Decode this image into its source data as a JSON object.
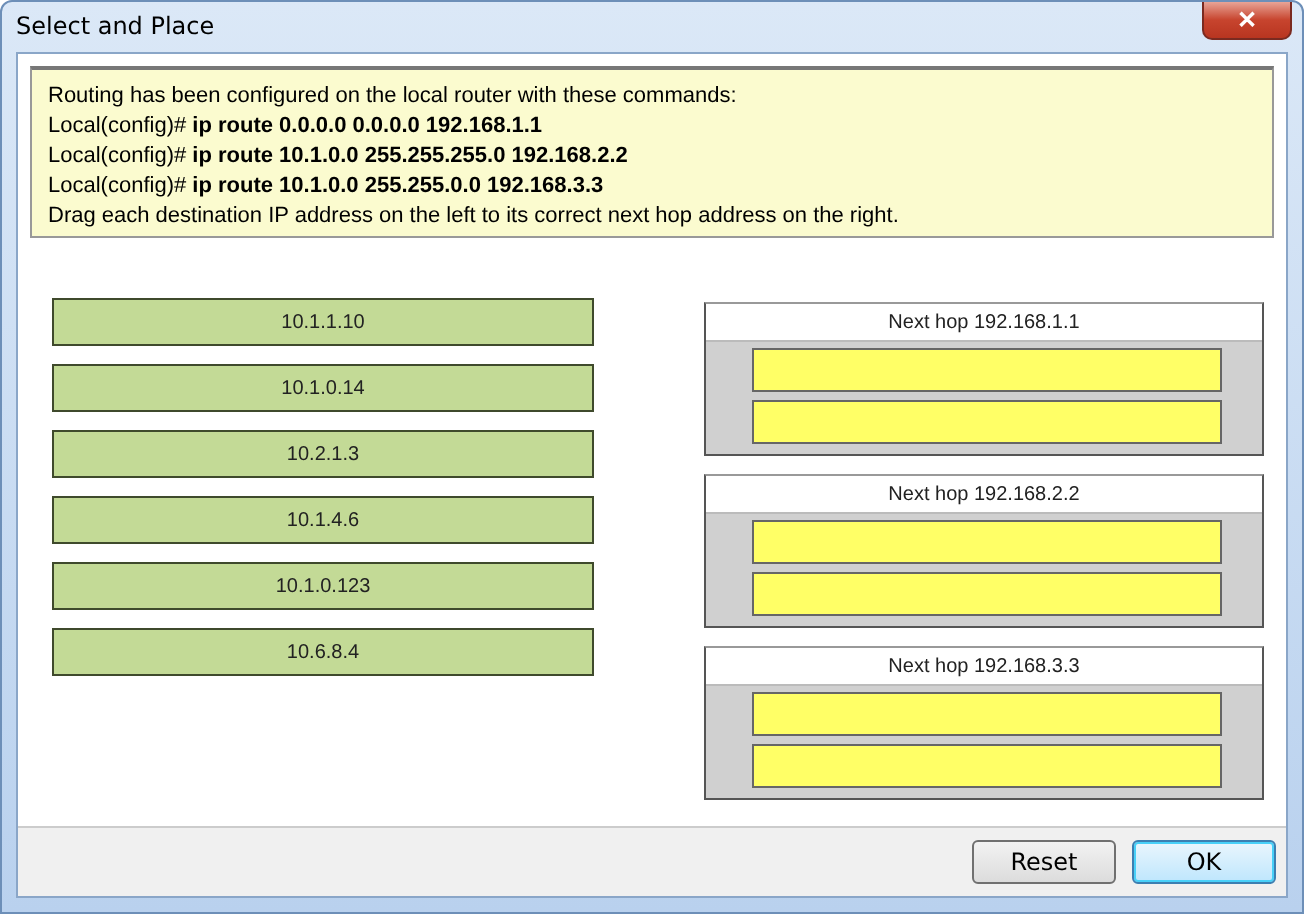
{
  "window": {
    "title": "Select and Place",
    "close": "✕"
  },
  "instructions": [
    "Routing has been configured on the local router with these commands:",
    "Local(config)# **ip route 0.0.0.0 0.0.0.0 192.168.1.1**",
    "Local(config)# **ip route 10.1.0.0  255.255.255.0 192.168.2.2**",
    "Local(config)# **ip route 10.1.0.0 255.255.0.0 192.168.3.3**",
    "Drag each destination IP address on the left to its correct next hop address on the right."
  ],
  "sources": [
    "10.1.1.10",
    "10.1.0.14",
    "10.2.1.3",
    "10.1.4.6",
    "10.1.0.123",
    "10.6.8.4"
  ],
  "targets": [
    {
      "header": "Next hop 192.168.1.1"
    },
    {
      "header": "Next hop 192.168.2.2"
    },
    {
      "header": "Next hop 192.168.3.3"
    }
  ],
  "buttons": [
    {
      "label": "Reset",
      "selected": false
    },
    {
      "label": "OK",
      "selected": true
    }
  ]
}
